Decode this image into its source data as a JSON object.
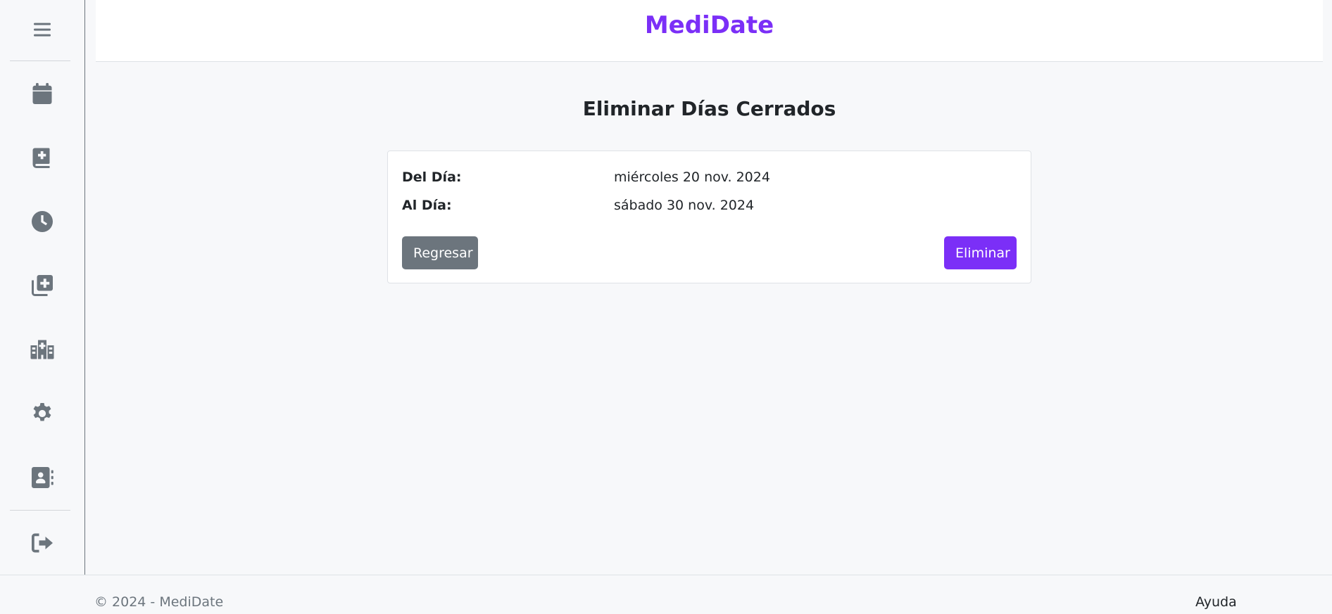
{
  "brand": {
    "title": "MediDate",
    "color": "#7b2ff7"
  },
  "sidebar": {
    "items": [
      {
        "name": "menu",
        "icon": "hamburger-icon"
      },
      {
        "name": "calendar",
        "icon": "calendar-icon"
      },
      {
        "name": "medical-book",
        "icon": "medical-book-icon"
      },
      {
        "name": "schedule",
        "icon": "clock-icon"
      },
      {
        "name": "add-copy",
        "icon": "add-copy-icon"
      },
      {
        "name": "hospital",
        "icon": "hospital-icon"
      },
      {
        "name": "settings",
        "icon": "gear-icon"
      },
      {
        "name": "contacts",
        "icon": "contact-book-icon"
      },
      {
        "name": "logout",
        "icon": "sign-out-icon"
      }
    ]
  },
  "main": {
    "title": "Eliminar Días Cerrados",
    "rows": [
      {
        "label": "Del Día:",
        "value": "miércoles 20 nov. 2024"
      },
      {
        "label": "Al Día:",
        "value": "sábado 30 nov. 2024"
      }
    ],
    "buttons": {
      "back": "Regresar",
      "delete": "Eliminar"
    }
  },
  "footer": {
    "copyright": "© 2024 - MediDate",
    "help": "Ayuda"
  }
}
